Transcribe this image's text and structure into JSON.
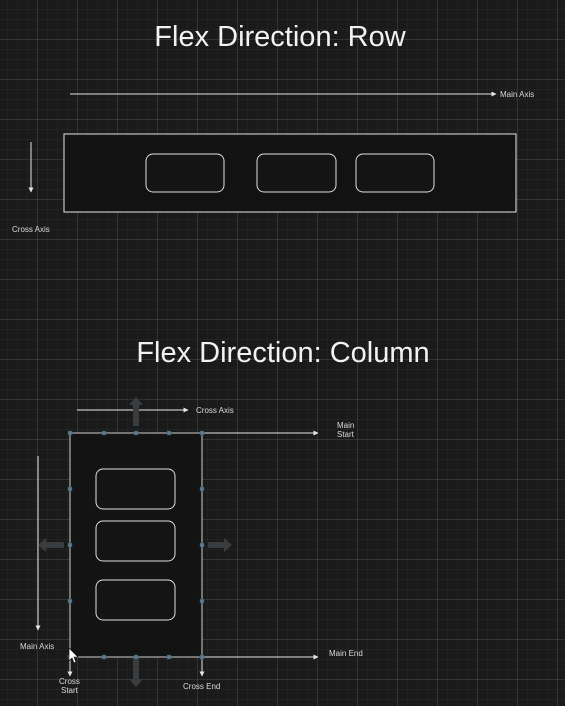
{
  "row_section": {
    "title": "Flex Direction: Row",
    "main_axis_label": "Main Axis",
    "cross_axis_label": "Cross Axis"
  },
  "column_section": {
    "title": "Flex Direction: Column",
    "cross_axis_label": "Cross Axis",
    "main_start_label_line1": "Main",
    "main_start_label_line2": "Start",
    "main_end_label": "Main End",
    "main_axis_label": "Main Axis",
    "cross_start_label_line1": "Cross",
    "cross_start_label_line2": "Start",
    "cross_end_label": "Cross End"
  }
}
